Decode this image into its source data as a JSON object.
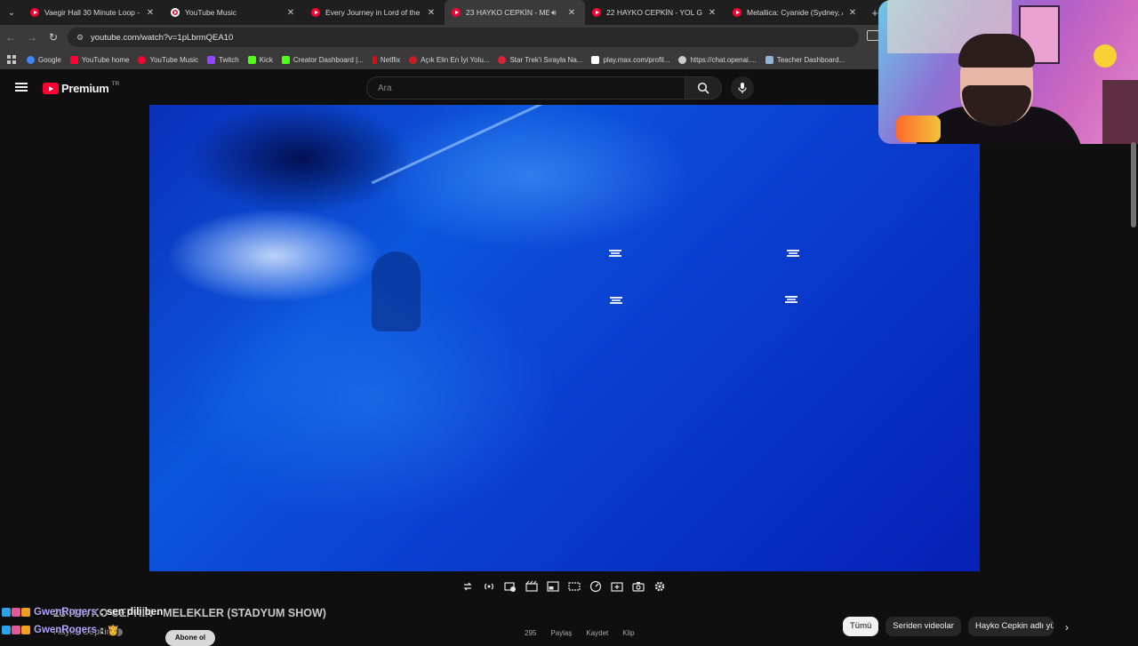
{
  "browser": {
    "tabs": [
      {
        "title": "Vaegir Hall 30 Minute Loop - Y",
        "icon": "youtube-icon"
      },
      {
        "title": "YouTube Music",
        "icon": "youtube-music-icon"
      },
      {
        "title": "Every Journey in Lord of the Ri",
        "icon": "youtube-icon"
      },
      {
        "title": "23 HAYKO CEPKİN - MELEK",
        "icon": "youtube-icon",
        "active": true
      },
      {
        "title": "22 HAYKO CEPKİN - YOL GÖZÜ",
        "icon": "youtube-icon"
      },
      {
        "title": "Metallica: Cyanide (Sydney, Au",
        "icon": "youtube-icon"
      }
    ],
    "url": "youtube.com/watch?v=1pLbrmQEA10",
    "bookmarks": [
      {
        "label": "Google",
        "color": "#4285f4"
      },
      {
        "label": "YouTube home",
        "color": "#ff0033"
      },
      {
        "label": "YouTube Music",
        "color": "#ff0033"
      },
      {
        "label": "Twitch",
        "color": "#9146ff"
      },
      {
        "label": "Kick",
        "color": "#53fc18"
      },
      {
        "label": "Creator Dashboard |...",
        "color": "#53fc18"
      },
      {
        "label": "Netflix",
        "color": "#e50914"
      },
      {
        "label": "Açık Elin En İyi Yolu...",
        "color": "#c81d25"
      },
      {
        "label": "Star Trek'i Sırayla Na...",
        "color": "#d23"
      },
      {
        "label": "play.max.com/profil...",
        "color": "#ffffff"
      },
      {
        "label": "https://chat.openai....",
        "color": "#cccccc"
      },
      {
        "label": "Teacher Dashboard...",
        "color": "#8fb3d9"
      }
    ]
  },
  "youtube": {
    "logo_text": "Premium",
    "country": "TR",
    "search_placeholder": "Ara"
  },
  "video": {
    "title": "23 HAYKO CEPKİN - MELEKLER (STADYUM SHOW)",
    "channel": "Hayko Cepkin",
    "subscribe_label": "Abone ol"
  },
  "chat": [
    {
      "user": "GwenRogers",
      "message": ": sen dili ben"
    },
    {
      "user": "GwenRogers",
      "message": ": 👸"
    }
  ],
  "actions": [
    "295",
    "Paylaş",
    "Kaydet",
    "Klip"
  ],
  "chips": [
    "Tümü",
    "Seriden videolar",
    "Hayko Cepkin adlı yü"
  ]
}
